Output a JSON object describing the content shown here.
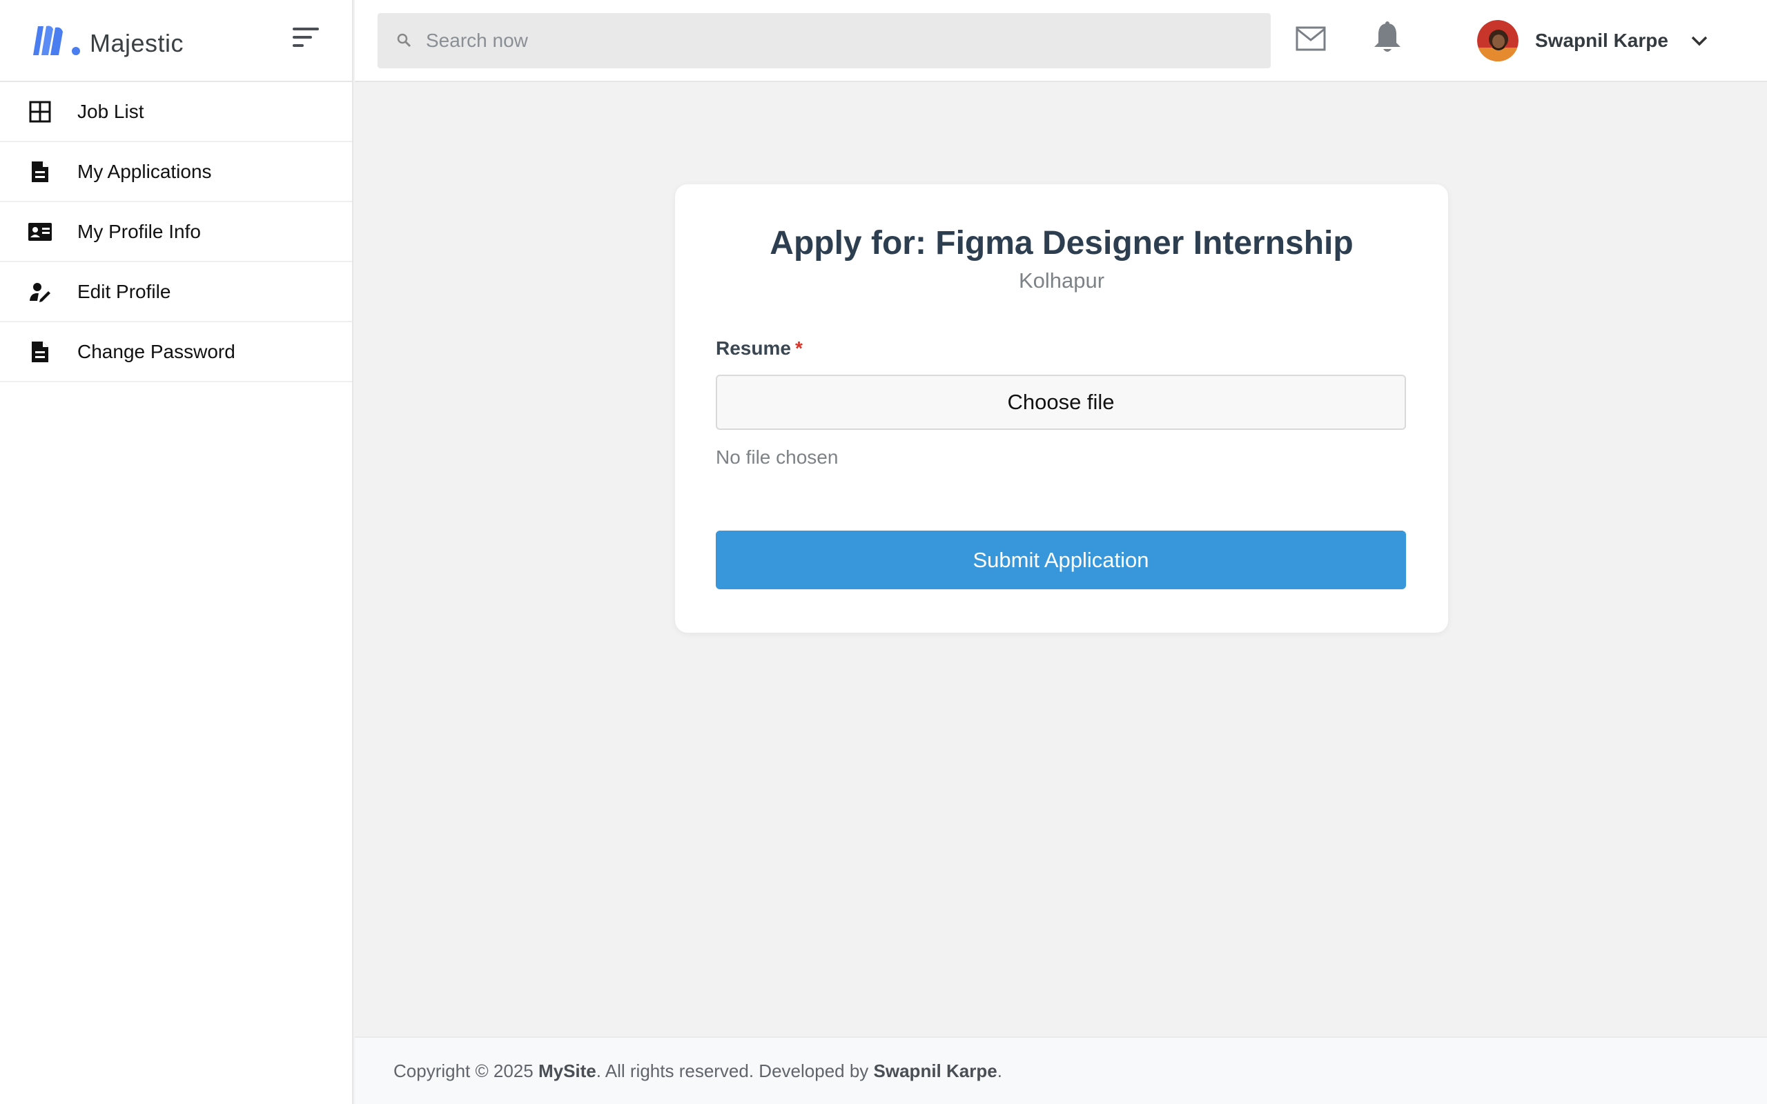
{
  "brand": {
    "name": "Majestic"
  },
  "sidebar": {
    "items": [
      {
        "label": "Job List",
        "icon": "grid-icon"
      },
      {
        "label": "My Applications",
        "icon": "document-icon"
      },
      {
        "label": "My Profile Info",
        "icon": "id-card-icon"
      },
      {
        "label": "Edit Profile",
        "icon": "user-edit-icon"
      },
      {
        "label": "Change Password",
        "icon": "document-icon"
      }
    ]
  },
  "header": {
    "search_placeholder": "Search now",
    "user_name": "Swapnil Karpe"
  },
  "form": {
    "title": "Apply for: Figma Designer Internship",
    "location": "Kolhapur",
    "resume_label": "Resume",
    "required_mark": "*",
    "file_button_label": "Choose file",
    "file_status": "No file chosen",
    "submit_label": "Submit Application"
  },
  "footer": {
    "prefix": "Copyright © 2025 ",
    "site": "MySite",
    "middle": ". All rights reserved. Developed by ",
    "developer": "Swapnil Karpe",
    "suffix": "."
  },
  "colors": {
    "accent": "#3897da",
    "brand_blue": "#4a7df0",
    "required": "#d9342b",
    "background": "#f2f2f2"
  }
}
